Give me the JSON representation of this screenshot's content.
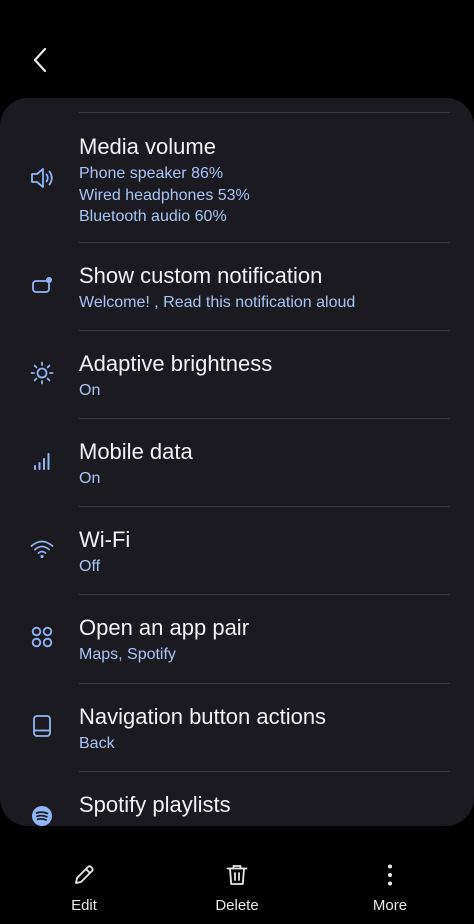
{
  "header": {
    "back_icon": "chevron-left-icon"
  },
  "settings": [
    {
      "icon": "volume-icon",
      "title": "Media volume",
      "subs": [
        "Phone speaker 86%",
        "Wired headphones 53%",
        "Bluetooth audio 60%"
      ]
    },
    {
      "icon": "notification-icon",
      "title": "Show custom notification",
      "subs": [
        "Welcome! , Read this notification aloud"
      ]
    },
    {
      "icon": "brightness-icon",
      "title": "Adaptive brightness",
      "subs": [
        "On"
      ]
    },
    {
      "icon": "signal-icon",
      "title": "Mobile data",
      "subs": [
        "On"
      ]
    },
    {
      "icon": "wifi-icon",
      "title": "Wi-Fi",
      "subs": [
        "Off"
      ]
    },
    {
      "icon": "app-pair-icon",
      "title": "Open an app pair",
      "subs": [
        "Maps, Spotify"
      ]
    },
    {
      "icon": "navigation-bar-icon",
      "title": "Navigation button actions",
      "subs": [
        "Back"
      ]
    },
    {
      "icon": "spotify-icon",
      "title": "Spotify playlists",
      "subs": []
    }
  ],
  "bottom_bar": {
    "edit": {
      "label": "Edit",
      "icon": "pencil-icon"
    },
    "delete": {
      "label": "Delete",
      "icon": "trash-icon"
    },
    "more": {
      "label": "More",
      "icon": "more-vertical-icon"
    }
  },
  "colors": {
    "background": "#000000",
    "card": "#1c1a21",
    "accent_text": "#a6c6f7",
    "icon_color": "#8fb7f5"
  }
}
